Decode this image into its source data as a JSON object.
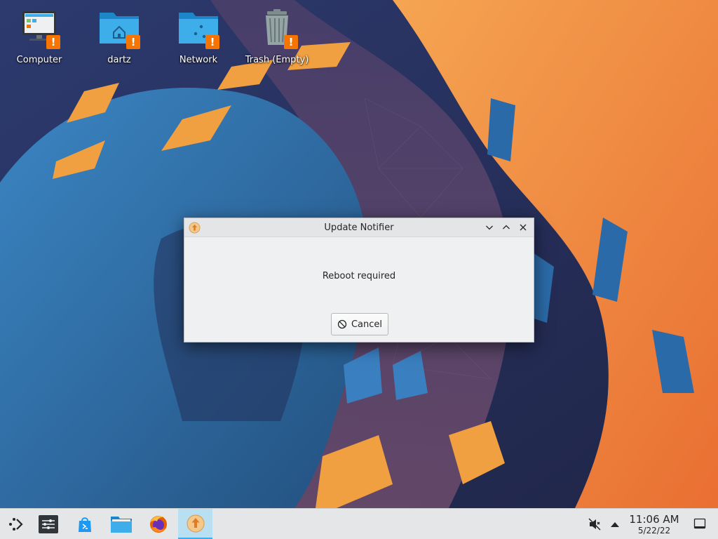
{
  "desktop": {
    "icons": [
      {
        "label": "Computer",
        "icon": "computer-icon"
      },
      {
        "label": "dartz",
        "icon": "home-folder-icon"
      },
      {
        "label": "Network",
        "icon": "network-folder-icon"
      },
      {
        "label": "Trash (Empty)",
        "icon": "trash-icon"
      }
    ],
    "badge": "!"
  },
  "dialog": {
    "title": "Update Notifier",
    "message": "Reboot required",
    "cancel_label": "Cancel",
    "controls": [
      "minimize",
      "maximize",
      "close"
    ]
  },
  "taskbar": {
    "items": [
      "application-launcher-icon",
      "system-settings-icon",
      "discover-icon",
      "dolphin-file-manager-icon",
      "firefox-icon",
      "update-notifier-icon"
    ],
    "active_item": "update-notifier-icon",
    "tray": [
      "volume-muted-icon",
      "tray-expand-icon"
    ],
    "clock": {
      "time": "11:06 AM",
      "date": "5/22/22"
    },
    "show_desktop": "show-desktop-icon"
  },
  "colors": {
    "accent": "#3daee9",
    "warning": "#f67400",
    "folder": "#3daee9",
    "wallpaper_orange": "#f08a40",
    "wallpaper_blue": "#2f6fae"
  }
}
